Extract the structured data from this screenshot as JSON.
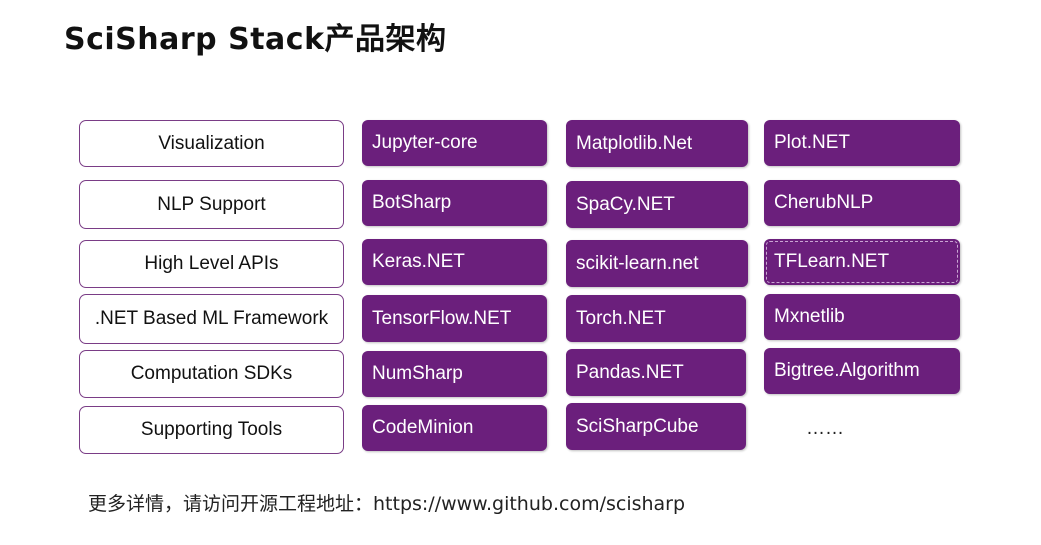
{
  "title": "SciSharp Stack产品架构",
  "rows": [
    {
      "category": "Visualization",
      "products": [
        "Jupyter-core",
        "Matplotlib.Net",
        "Plot.NET"
      ]
    },
    {
      "category": "NLP Support",
      "products": [
        "BotSharp",
        "SpaCy.NET",
        "CherubNLP"
      ]
    },
    {
      "category": "High Level APIs",
      "products": [
        "Keras.NET",
        "scikit-learn.net",
        "TFLearn.NET"
      ]
    },
    {
      "category": ".NET Based ML Framework",
      "products": [
        "TensorFlow.NET",
        "Torch.NET",
        "Mxnetlib"
      ]
    },
    {
      "category": "Computation SDKs",
      "products": [
        "NumSharp",
        "Pandas.NET",
        "Bigtree.Algorithm"
      ]
    },
    {
      "category": "Supporting Tools",
      "products": [
        "CodeMinion",
        "SciSharpCube"
      ]
    }
  ],
  "ellipsis": "……",
  "footer": "更多详情，请访问开源工程地址：https://www.github.com/scisharp",
  "colors": {
    "product_fill": "#6b1f7c",
    "category_border": "#7a3d86"
  }
}
